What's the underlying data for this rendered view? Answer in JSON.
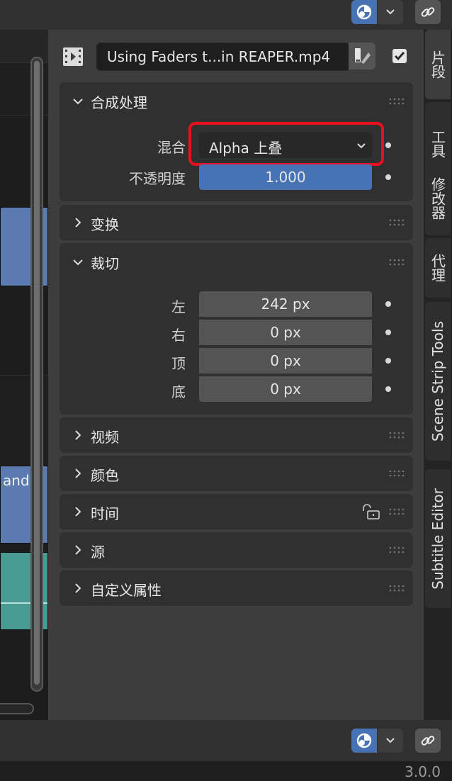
{
  "header": {
    "overlay_icon": "overlay-icon",
    "dropdown_icon": "chevron-down-icon",
    "link_icon": "link-icon"
  },
  "timeline": {
    "clip_text": "and I"
  },
  "strip": {
    "name": "Using Faders t...in REAPER.mp4",
    "strip_icon": "film-strip-icon",
    "color_tag_icon": "color-tag-icon",
    "enabled": true
  },
  "sections": {
    "compositing": {
      "title": "合成处理",
      "expanded": true,
      "blend_label": "混合",
      "blend_value": "Alpha 上叠",
      "opacity_label": "不透明度",
      "opacity_value": "1.000",
      "opacity_fraction": 1.0
    },
    "transform": {
      "title": "变换",
      "expanded": false
    },
    "crop": {
      "title": "裁切",
      "expanded": true,
      "fields": [
        {
          "label": "左",
          "value": "242 px"
        },
        {
          "label": "右",
          "value": "0 px"
        },
        {
          "label": "顶",
          "value": "0 px"
        },
        {
          "label": "底",
          "value": "0 px"
        }
      ]
    },
    "video": {
      "title": "视频",
      "expanded": false
    },
    "color": {
      "title": "颜色",
      "expanded": false
    },
    "time": {
      "title": "时间",
      "expanded": false,
      "lock_icon": "unlock-icon"
    },
    "source": {
      "title": "源",
      "expanded": false
    },
    "custom_props": {
      "title": "自定义属性",
      "expanded": false
    }
  },
  "tabs": [
    {
      "label": "片段",
      "active": true
    },
    {
      "label": "工具",
      "active": false
    },
    {
      "label": "修改器",
      "active": false
    },
    {
      "label": "代理",
      "active": false
    },
    {
      "label": "Scene Strip Tools",
      "active": false
    },
    {
      "label": "Subtitle Editor",
      "active": false
    }
  ],
  "status": {
    "version": "3.0.0"
  },
  "colors": {
    "accent_blue": "#4772b3",
    "highlight_red": "#e8101e",
    "strip_blue": "#5a7ab0",
    "strip_teal": "#4a9a94"
  }
}
